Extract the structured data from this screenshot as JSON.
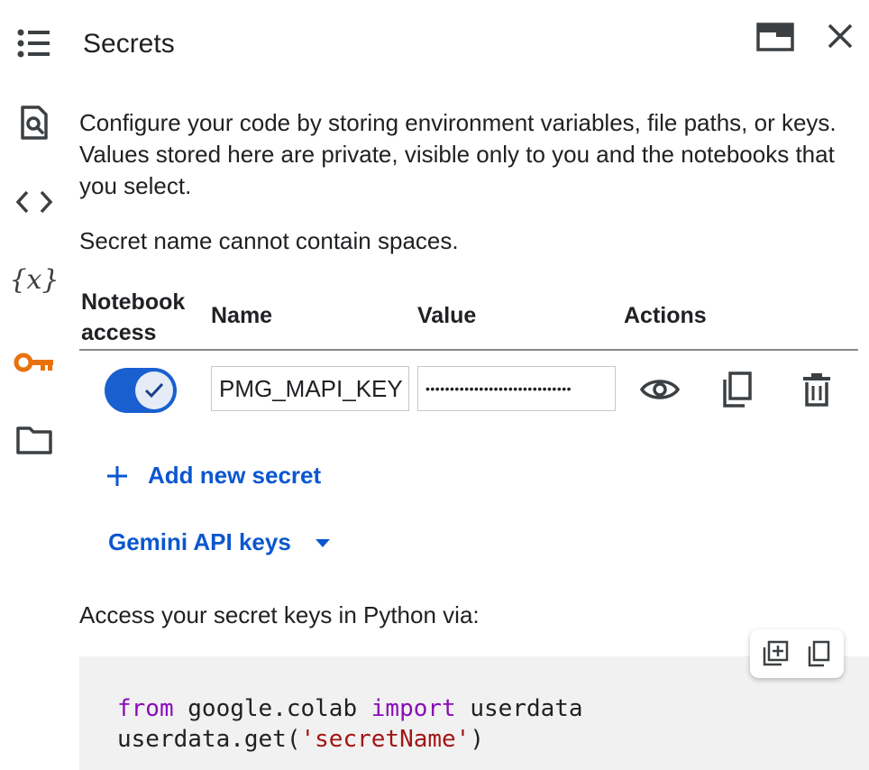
{
  "panel": {
    "title": "Secrets",
    "description": "Configure your code by storing environment variables, file paths, or keys. Values stored here are private, visible only to you and the notebooks that you select.",
    "note": "Secret name cannot contain spaces."
  },
  "rail": {
    "items": [
      "toc-icon",
      "find-icon",
      "code-snippets-icon",
      "variables-icon",
      "key-icon",
      "folder-icon"
    ],
    "active": "key-icon",
    "accent": "#e8710a"
  },
  "table": {
    "headers": {
      "access_line1": "Notebook",
      "access_line2": "access",
      "name": "Name",
      "value": "Value",
      "actions": "Actions"
    },
    "rows": [
      {
        "access_enabled": true,
        "name": "PMG_MAPI_KEY",
        "value": "••••••••••••••••••••••••••••••"
      }
    ]
  },
  "add_secret_label": "Add new secret",
  "gemini_label": "Gemini API keys",
  "access_label": "Access your secret keys in Python via:",
  "code": {
    "line1_kw1": "from",
    "line1_mod": " google.colab ",
    "line1_kw2": "import",
    "line1_name": " userdata",
    "line2_call": "userdata.get(",
    "line2_str": "'secretName'",
    "line2_end": ")"
  },
  "colors": {
    "accent_blue": "#0b57d0",
    "toggle": "#1a5fd0",
    "keyword": "#8a0bb8",
    "string": "#a31515"
  }
}
